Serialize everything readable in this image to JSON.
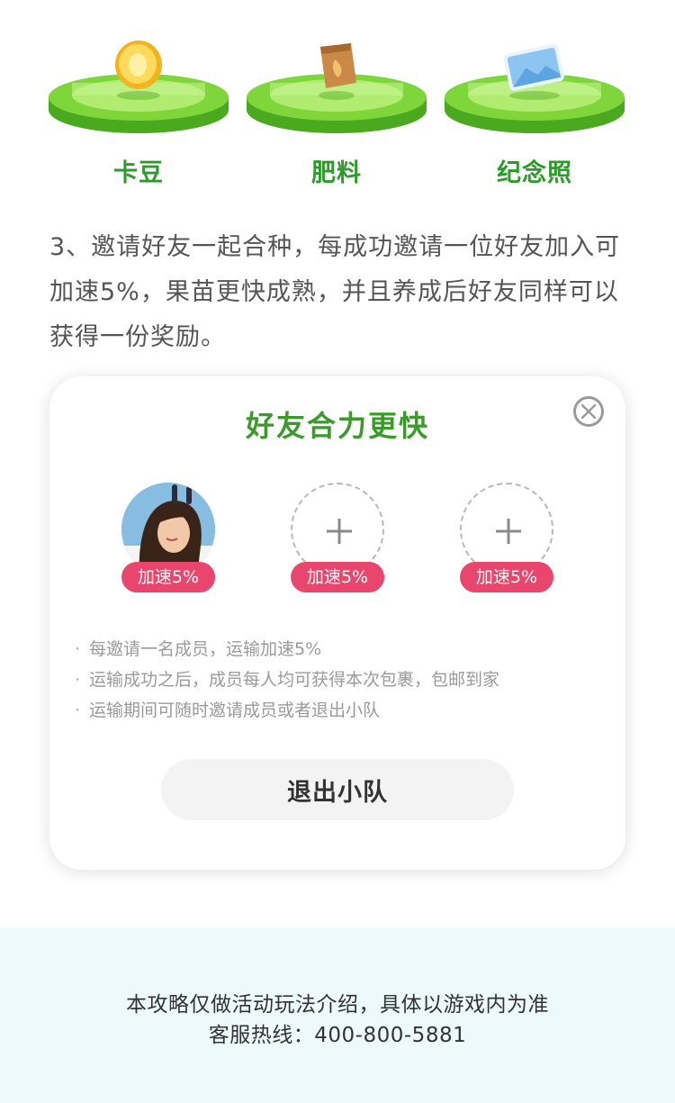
{
  "rewards": [
    {
      "label": "卡豆",
      "icon": "coin-icon"
    },
    {
      "label": "肥料",
      "icon": "fertilizer-bag-icon"
    },
    {
      "label": "纪念照",
      "icon": "photo-card-icon"
    }
  ],
  "rule_text": "3、邀请好友一起合种，每成功邀请一位好友加入可加速5%，果苗更快成熟，并且养成后好友同样可以获得一份奖励。",
  "team_card": {
    "title": "好友合力更快",
    "members": [
      {
        "state": "joined",
        "boost": "加速5%"
      },
      {
        "state": "empty",
        "boost": "加速5%"
      },
      {
        "state": "empty",
        "boost": "加速5%"
      }
    ],
    "notes": [
      "每邀请一名成员，运输加速5%",
      "运输成功之后，成员每人均可获得本次包裹，包邮到家",
      "运输期间可随时邀请成员或者退出小队"
    ],
    "bullet": "·",
    "quit_button": "退出小队"
  },
  "footer": {
    "disclaimer": "本攻略仅做活动玩法介绍，具体以游戏内为准",
    "hotline": "客服热线：400-800-5881"
  },
  "colors": {
    "accent_green": "#2f9a2c",
    "badge_pink": "#e8466c",
    "footer_bg": "#eef9fc"
  }
}
